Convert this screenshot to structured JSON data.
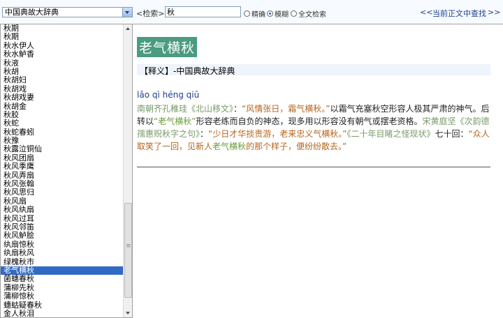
{
  "toolbar": {
    "dictionary": "中国典故大辞典",
    "search_label": "<检索>",
    "search_value": "秋",
    "modes": [
      {
        "label": "精确",
        "checked": false
      },
      {
        "label": "模糊",
        "checked": true
      },
      {
        "label": "全文检索",
        "checked": false
      }
    ],
    "prev": "<<",
    "find_in_text": "当前正文中查找",
    "next": ">>"
  },
  "list": {
    "items": [
      "秋期",
      "秋期",
      "秋水伊人",
      "秋水鲈香",
      "秋液",
      "秋胡",
      "秋胡妇",
      "秋胡戏",
      "秋胡戏妻",
      "秋胡金",
      "秋胶",
      "秋蛇",
      "秋蛇春蚓",
      "秋豫",
      "秋露泣铜仙",
      "秋风团扇",
      "秋风季鹰",
      "秋风弄扇",
      "秋风张翰",
      "秋风思归",
      "秋风扇",
      "秋风纨扇",
      "秋风过耳",
      "秋风邻笛",
      "秋风鲈脍",
      "纨扇惊秋",
      "纨扇秋风",
      "绿槐秋市",
      "老气横秋",
      "菌蟪春秋",
      "蒲柳先秋",
      "蒲柳惊秋",
      "蟪蛄疑春秋",
      "金人秋泪"
    ],
    "selected": 28
  },
  "entry": {
    "title": "老气横秋",
    "shiyi": "【释义】-中国典故大辞典",
    "pinyin": "lǎo qì héng qiū",
    "segments": [
      {
        "text": "南朝齐孔稚珪《北山移文》",
        "style": "src"
      },
      {
        "text": "：",
        "style": ""
      },
      {
        "text": "“风情张日，霜气横秋。”",
        "style": "quote"
      },
      {
        "text": "以霜气充塞秋空形容人极其严肃的神气。后转以",
        "style": ""
      },
      {
        "text": "“老气横秋”",
        "style": "hl"
      },
      {
        "text": "形容老练而自负的神态，现多用以形容没有朝气或摆老资格。",
        "style": ""
      },
      {
        "text": "宋黄庭坚《次韵德孺惠贶秋字之句》",
        "style": "src"
      },
      {
        "text": "：",
        "style": ""
      },
      {
        "text": "“少日才华掞贵游，老来忠义气横秋。”",
        "style": "quote"
      },
      {
        "text": "《二十年目睹之怪现状》",
        "style": "src"
      },
      {
        "text": "七十回：",
        "style": ""
      },
      {
        "text": "“众人取笑了一回，见新人",
        "style": "quote"
      },
      {
        "text": "老气横秋",
        "style": "hl"
      },
      {
        "text": "的那个样子，便纷纷散去。”",
        "style": "quote"
      }
    ]
  }
}
